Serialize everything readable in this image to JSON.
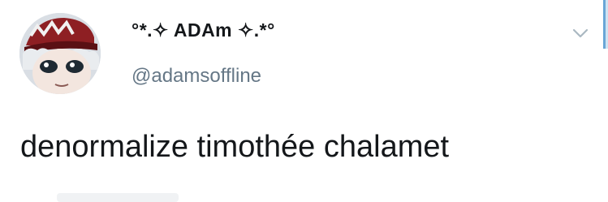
{
  "tweet": {
    "display_name": "°*.✧ ADAm ✧.*°",
    "handle": "@adamsoffline",
    "text": "denormalize timothée chalamet"
  },
  "icons": {
    "menu": "chevron-down-icon",
    "avatar": "avatar-image"
  },
  "colors": {
    "text": "#14171a",
    "secondary": "#657786",
    "chevron": "#aab8c2",
    "scroll_accent": "#6aa6d6"
  }
}
